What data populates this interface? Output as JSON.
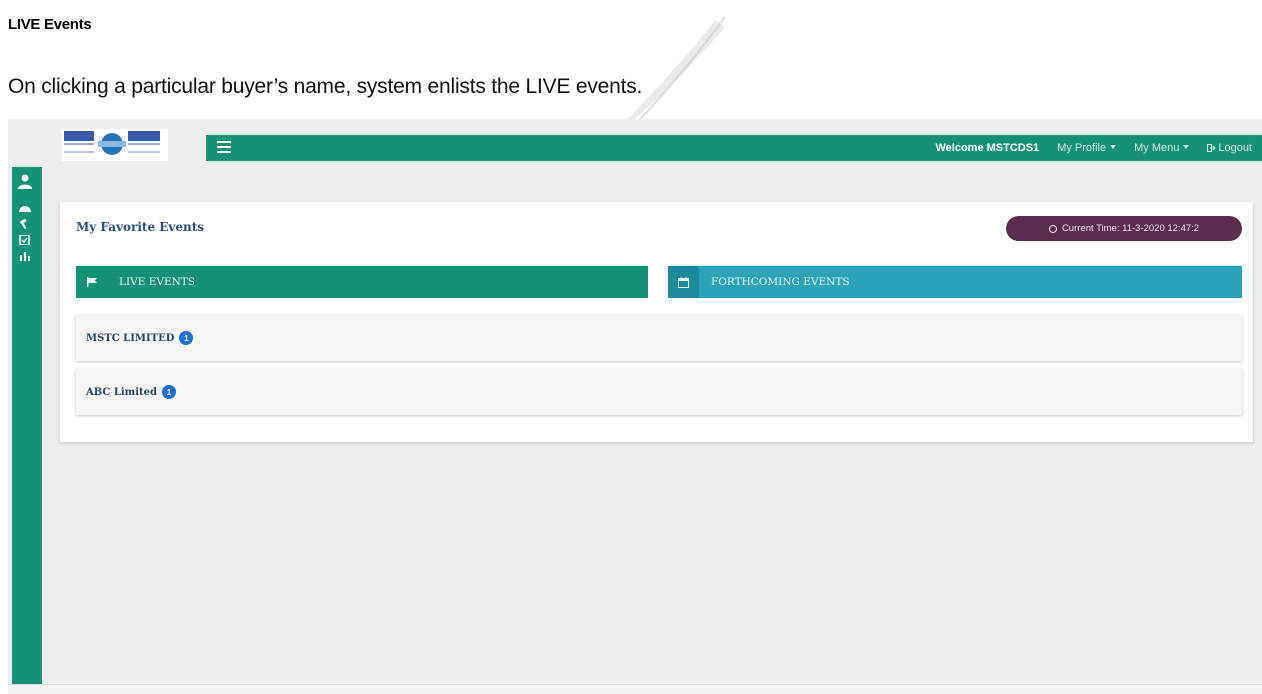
{
  "document": {
    "heading": "LIVE Events",
    "paragraph": "On clicking a particular buyer’s name, system enlists the LIVE events."
  },
  "header": {
    "welcome": "Welcome MSTCDS1",
    "my_profile": "My Profile",
    "my_menu": "My Menu",
    "logout": "Logout"
  },
  "sidebar": {
    "icons": [
      "user-icon",
      "dashboard-icon",
      "gavel-icon",
      "checklist-icon",
      "chart-icon"
    ]
  },
  "card": {
    "title": "My Favorite Events",
    "current_time": "Current Time: 11-3-2020 12:47:2"
  },
  "tabs": [
    {
      "label": "LIVE EVENTS",
      "icon": "flag-icon"
    },
    {
      "label": "FORTHCOMING EVENTS",
      "icon": "calendar-icon"
    }
  ],
  "buyers": [
    {
      "name": "MSTC LIMITED",
      "count": "1"
    },
    {
      "name": "ABC Limited",
      "count": "1"
    }
  ],
  "colors": {
    "primary_teal": "#159178",
    "forthcoming_blue": "#2aa3b9",
    "time_pill": "#5c2c4f",
    "badge": "#1d6fd6"
  }
}
